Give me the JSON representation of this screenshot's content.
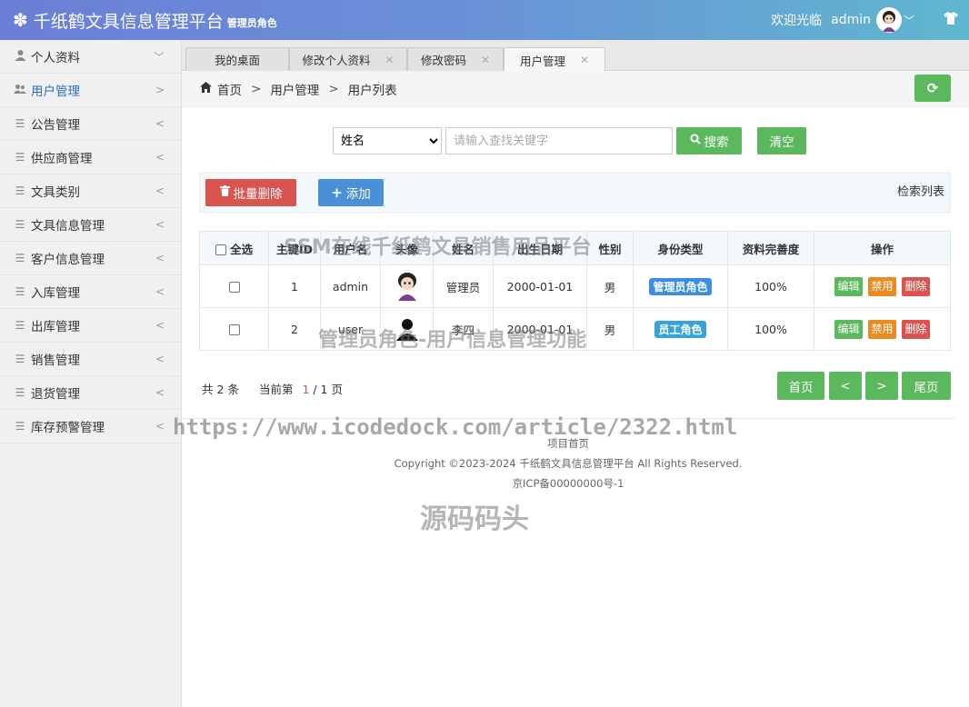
{
  "header": {
    "title": "千纸鹤文具信息管理平台",
    "role": "管理员角色",
    "welcome": "欢迎光临",
    "username": "admin"
  },
  "sidebar": {
    "items": [
      {
        "label": "个人资料",
        "icon": "user-icon",
        "arrow": "﹀"
      },
      {
        "label": "用户管理",
        "icon": "users-icon",
        "arrow": ">"
      },
      {
        "label": "公告管理",
        "icon": "list-icon",
        "arrow": "<"
      },
      {
        "label": "供应商管理",
        "icon": "list-icon",
        "arrow": "<"
      },
      {
        "label": "文具类别",
        "icon": "list-icon",
        "arrow": "<"
      },
      {
        "label": "文具信息管理",
        "icon": "list-icon",
        "arrow": "<"
      },
      {
        "label": "客户信息管理",
        "icon": "list-icon",
        "arrow": "<"
      },
      {
        "label": "入库管理",
        "icon": "list-icon",
        "arrow": "<"
      },
      {
        "label": "出库管理",
        "icon": "list-icon",
        "arrow": "<"
      },
      {
        "label": "销售管理",
        "icon": "list-icon",
        "arrow": "<"
      },
      {
        "label": "退货管理",
        "icon": "list-icon",
        "arrow": "<"
      },
      {
        "label": "库存预警管理",
        "icon": "list-icon",
        "arrow": "<"
      }
    ]
  },
  "tabs": [
    {
      "label": "我的桌面"
    },
    {
      "label": "修改个人资料"
    },
    {
      "label": "修改密码"
    },
    {
      "label": "用户管理"
    }
  ],
  "breadcrumb": {
    "home": "首页",
    "level1": "用户管理",
    "level2": "用户列表"
  },
  "search": {
    "field_selected": "姓名",
    "placeholder": "请输入查找关键字",
    "search_label": "搜索",
    "clear_label": "清空"
  },
  "toolbar": {
    "batch_delete_label": "批量删除",
    "add_label": "添加",
    "title": "检索列表"
  },
  "table": {
    "headers": {
      "select_all": "全选",
      "id": "主键ID",
      "username": "用户名",
      "avatar": "头像",
      "name": "姓名",
      "birthday": "出生日期",
      "gender": "性别",
      "role": "身份类型",
      "completeness": "资料完善度",
      "actions": "操作"
    },
    "rows": [
      {
        "id": "1",
        "username": "admin",
        "name": "管理员",
        "birthday": "2000-01-01",
        "gender": "男",
        "role": "管理员角色",
        "role_color": "#3a8ee6",
        "completeness": "100%"
      },
      {
        "id": "2",
        "username": "user",
        "name": "李四",
        "birthday": "2000-01-01",
        "gender": "男",
        "role": "员工角色",
        "role_color": "#36a3d9",
        "completeness": "100%"
      }
    ],
    "actions": {
      "edit": "编辑",
      "ban": "禁用",
      "delete": "删除"
    }
  },
  "pagination": {
    "total_prefix": "共",
    "total": "2",
    "total_suffix": "条",
    "current_prefix": "当前第",
    "current": "1",
    "pages_suffix": "/ 1 页",
    "first": "首页",
    "prev": "<",
    "next": ">",
    "last": "尾页"
  },
  "footer": {
    "link": "项目首页",
    "copyright": "Copyright ©2023-2024 千纸鹤文具信息管理平台 All Rights Reserved.",
    "icp": "京ICP备00000000号-1"
  },
  "watermarks": {
    "line1": "SSM在线千纸鹤文具销售用品平台",
    "line2": "管理员角色-用户信息管理功能",
    "url": "https://www.icodedock.com/article/2322.html",
    "brand": "源码码头"
  },
  "colors": {
    "primary_green": "#5cb85c",
    "danger_red": "#d9534f",
    "warning_orange": "#ec8a1f",
    "info_blue": "#4a90d9"
  }
}
